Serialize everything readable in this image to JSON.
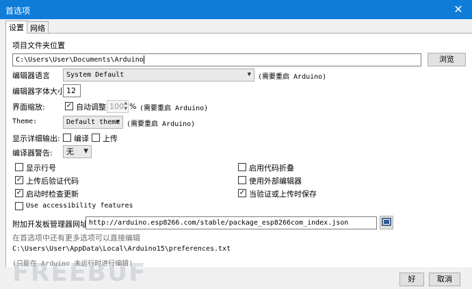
{
  "window": {
    "title": "首选项",
    "close": "✕"
  },
  "tabs": [
    "设置",
    "网络"
  ],
  "sketchbook": {
    "label": "项目文件夹位置",
    "path": "C:\\Users\\User\\Documents\\Arduino",
    "browse": "浏览"
  },
  "editor_language": {
    "label": "编辑器语言",
    "value": "System Default",
    "note": "(需要重启 Arduino)"
  },
  "font_size": {
    "label": "编辑器字体大小",
    "value": "12"
  },
  "scaling": {
    "label": "界面缩放:",
    "auto_label": "自动调整",
    "auto_checked": true,
    "percent": "100",
    "unit": "%",
    "note": "(需要重启 Arduino)"
  },
  "theme": {
    "label": "Theme:",
    "value": "Default theme",
    "note": "(需要重启 Arduino)"
  },
  "verbose": {
    "label": "显示详细输出:",
    "compile_label": "编译",
    "compile_checked": false,
    "upload_label": "上传",
    "upload_checked": false
  },
  "warnings": {
    "label": "编译器警告:",
    "value": "无"
  },
  "options_left": [
    {
      "label": "显示行号",
      "checked": false
    },
    {
      "label": "上传后验证代码",
      "checked": true
    },
    {
      "label": "启动时检查更新",
      "checked": true
    },
    {
      "label": "Use accessibility features",
      "checked": false
    }
  ],
  "options_right": [
    {
      "label": "启用代码折叠",
      "checked": false
    },
    {
      "label": "使用外部编辑器",
      "checked": false
    },
    {
      "label": "当验证或上传时保存",
      "checked": true
    }
  ],
  "boards_url": {
    "label": "附加开发板管理器网址:",
    "value": "http://arduino.esp8266.com/stable/package_esp8266com_index.json"
  },
  "more_prefs": "在首选项中还有更多选项可以直接编辑",
  "prefs_path": "C:\\Users\\User\\AppData\\Local\\Arduino15\\preferences.txt",
  "edit_note": "(只能在 Arduino 未运行时进行编辑)",
  "watermark": "FREEBUF",
  "buttons": {
    "ok": "好",
    "cancel": "取消"
  },
  "icons": {
    "close": "close-icon",
    "check": "check-icon",
    "url-list": "list-window-icon"
  }
}
